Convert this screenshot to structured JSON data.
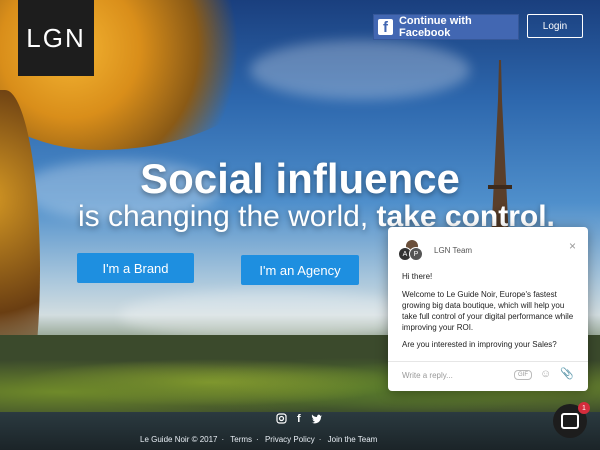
{
  "brand": {
    "logo_text": "LGN"
  },
  "header": {
    "facebook_label": "Continue with Facebook",
    "facebook_icon_glyph": "f",
    "login_label": "Login"
  },
  "hero": {
    "title": "Social influence",
    "subtitle_prefix": "is changing the world,",
    "subtitle_emphasis": "take control."
  },
  "cta": {
    "brand_label": "I'm a Brand",
    "agency_label": "I'm an Agency"
  },
  "social": {
    "instagram_icon": "instagram-icon",
    "facebook_glyph": "f",
    "twitter_icon": "twitter-icon"
  },
  "footer": {
    "items": [
      "Le Guide Noir © 2017",
      "Terms",
      "Privacy Policy",
      "Join the Team"
    ]
  },
  "chat": {
    "team_name": "LGN Team",
    "avatar_a": "A",
    "avatar_p": "P",
    "close_glyph": "×",
    "greeting": "Hi there!",
    "welcome": "Welcome to Le Guide Noir, Europe's fastest growing big data boutique, which will help you take full control of your digital performance while improving your ROI.",
    "question": "Are you interested in improving your Sales?",
    "reply_placeholder": "Write a reply...",
    "gif_label": "GIF",
    "emoji_glyph": "☺",
    "attach_glyph": "📎"
  },
  "launcher": {
    "badge_count": "1"
  },
  "colors": {
    "primary": "#1e8fe0",
    "facebook": "#4267b2",
    "dark": "#1d1d1d",
    "badge": "#d42c3c"
  }
}
